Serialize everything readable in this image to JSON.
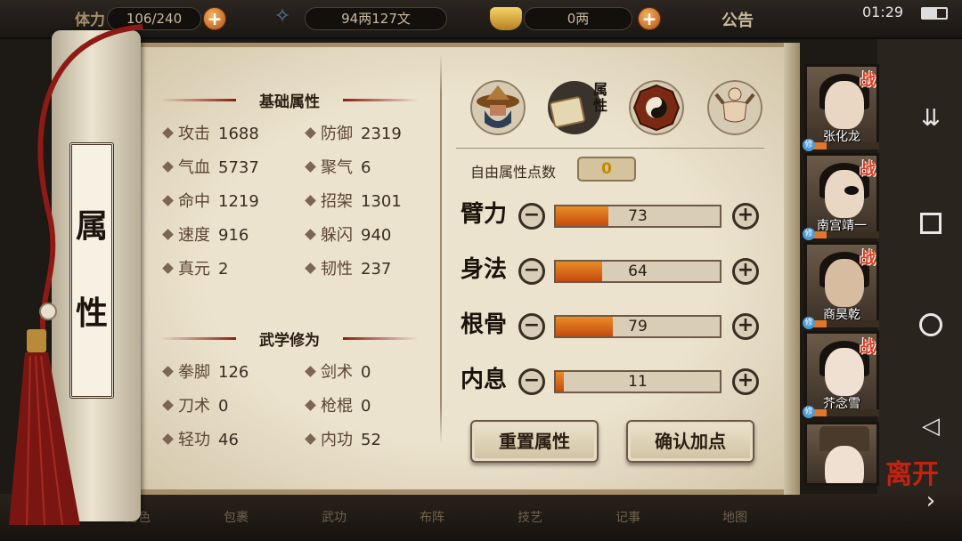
{
  "topbar": {
    "stamina_label": "体力",
    "stamina": "106/240",
    "money": "94两127文",
    "gold": "0两",
    "notice": "公告",
    "time": "01:29"
  },
  "scroll_title": [
    "属",
    "性"
  ],
  "basic": {
    "title": "基础属性",
    "stats": [
      {
        "label": "攻击",
        "value": "1688"
      },
      {
        "label": "防御",
        "value": "2319"
      },
      {
        "label": "气血",
        "value": "5737"
      },
      {
        "label": "聚气",
        "value": "6"
      },
      {
        "label": "命中",
        "value": "1219"
      },
      {
        "label": "招架",
        "value": "1301"
      },
      {
        "label": "速度",
        "value": "916"
      },
      {
        "label": "躲闪",
        "value": "940"
      },
      {
        "label": "真元",
        "value": "2"
      },
      {
        "label": "韧性",
        "value": "237"
      }
    ]
  },
  "martial": {
    "title": "武学修为",
    "stats": [
      {
        "label": "拳脚",
        "value": "126"
      },
      {
        "label": "剑术",
        "value": "0"
      },
      {
        "label": "刀术",
        "value": "0"
      },
      {
        "label": "枪棍",
        "value": "0"
      },
      {
        "label": "轻功",
        "value": "46"
      },
      {
        "label": "内功",
        "value": "52"
      }
    ]
  },
  "icons": {
    "tab_label": "属性",
    "names": [
      "hat-character-icon",
      "attribute-scroll-icon",
      "bagua-icon",
      "muscle-figure-icon"
    ]
  },
  "free_points": {
    "label": "自由属性点数",
    "value": "0"
  },
  "attrs": [
    {
      "name": "臂力",
      "value": "73",
      "fill": 0.32
    },
    {
      "name": "身法",
      "value": "64",
      "fill": 0.28
    },
    {
      "name": "根骨",
      "value": "79",
      "fill": 0.35
    },
    {
      "name": "内息",
      "value": "11",
      "fill": 0.05
    }
  ],
  "buttons": {
    "minus": "−",
    "plus": "+",
    "reset": "重置属性",
    "confirm": "确认加点"
  },
  "party": {
    "battle_mark": "战",
    "xiu_mark": "修",
    "members": [
      {
        "name": "张化龙"
      },
      {
        "name": "南宫靖一"
      },
      {
        "name": "商昊乾"
      },
      {
        "name": "芥念雪"
      },
      {
        "name": ""
      }
    ]
  },
  "leave_seal": "离开",
  "bottom_menu": [
    "角色",
    "包裹",
    "武功",
    "布阵",
    "技艺",
    "记事",
    "地图"
  ],
  "colors": {
    "bar": "#d9661a",
    "battle": "#e23b1e",
    "accent": "#8a1f10"
  }
}
